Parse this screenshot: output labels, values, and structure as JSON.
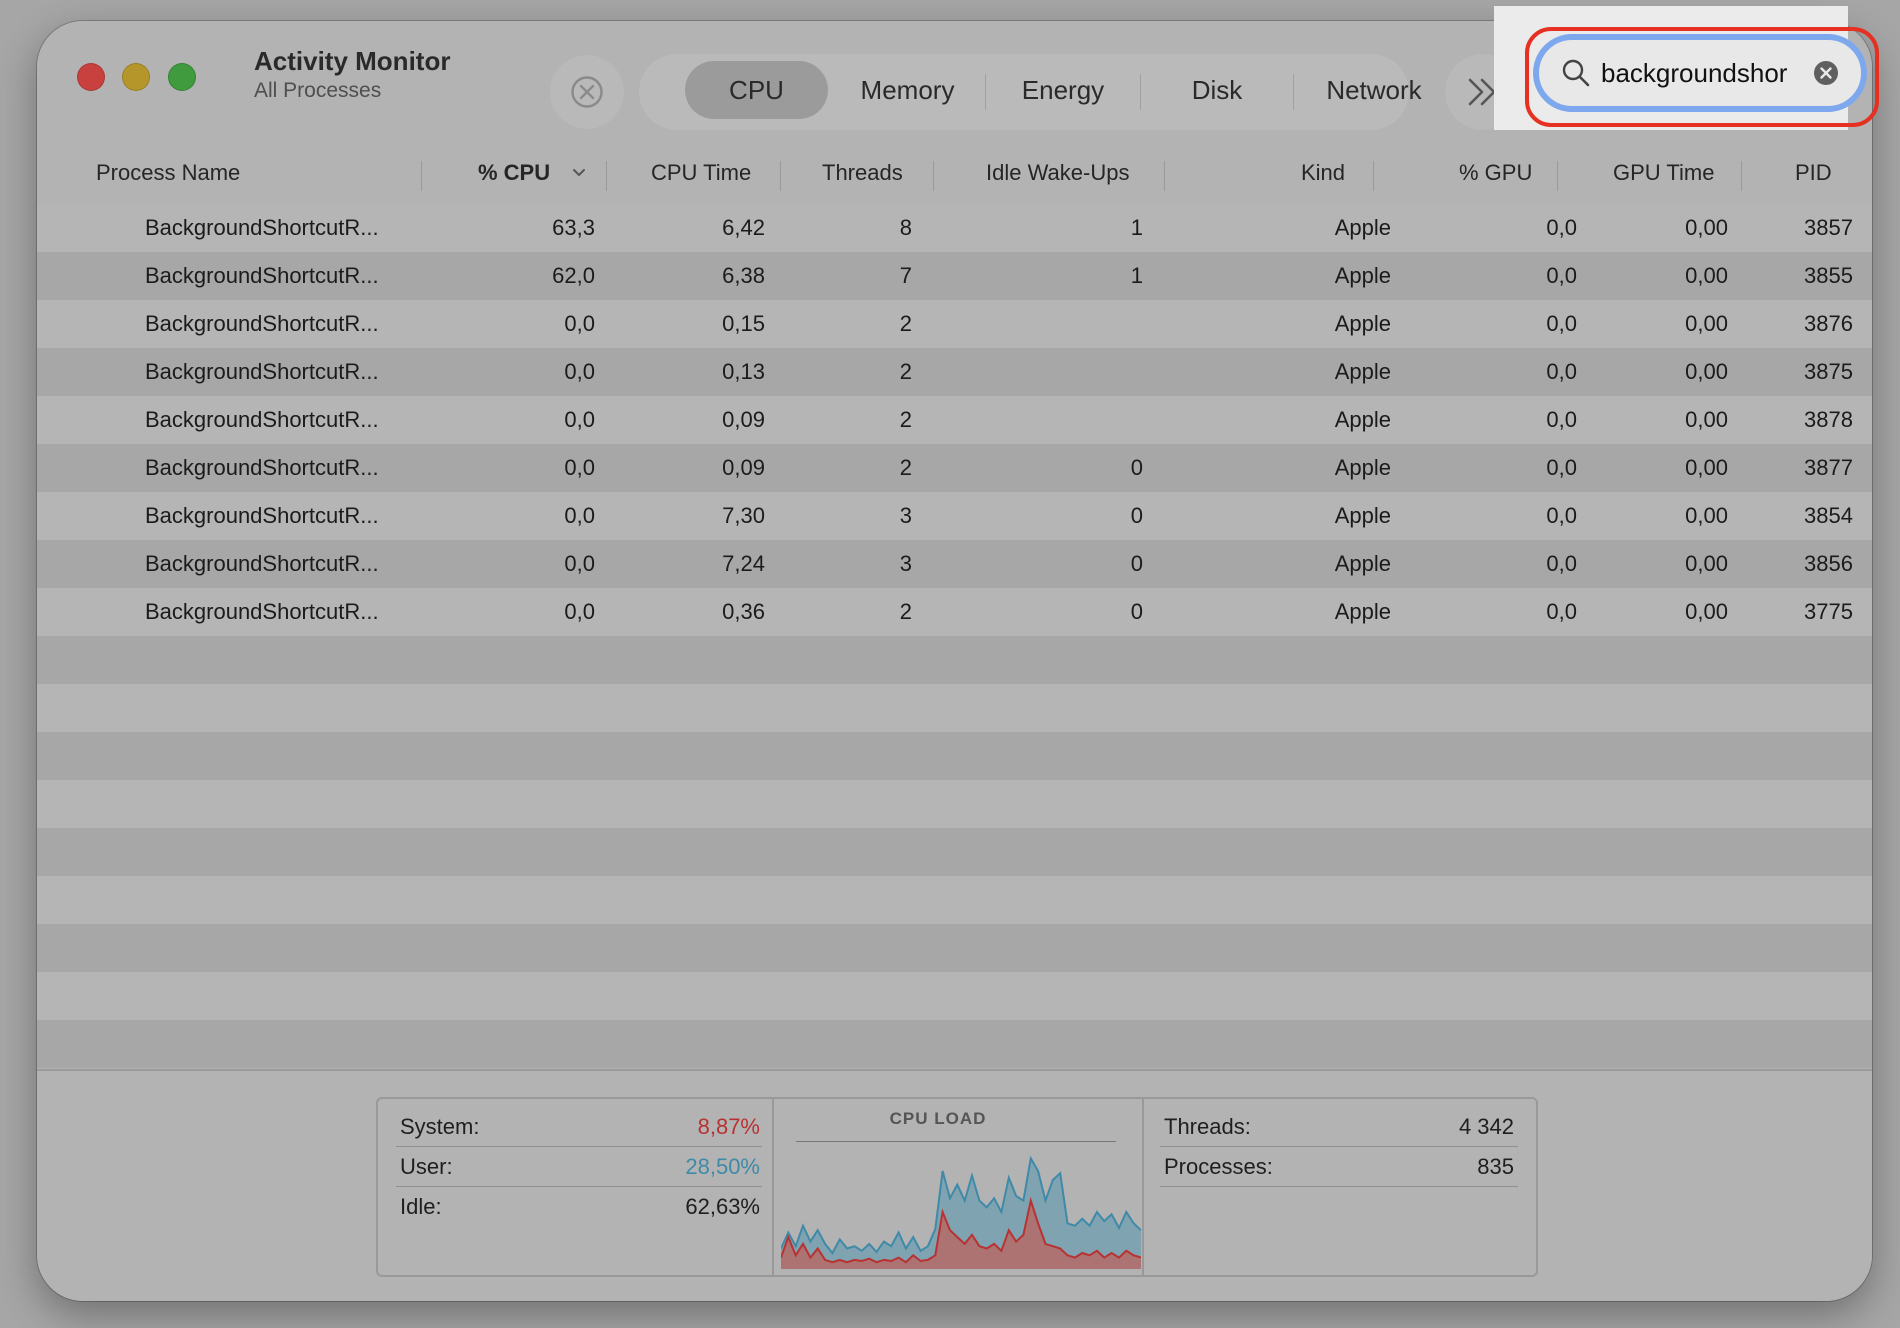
{
  "window": {
    "title": "Activity Monitor",
    "subtitle": "All Processes"
  },
  "tabs": [
    {
      "label": "CPU",
      "selected": true
    },
    {
      "label": "Memory",
      "selected": false
    },
    {
      "label": "Energy",
      "selected": false
    },
    {
      "label": "Disk",
      "selected": false
    },
    {
      "label": "Network",
      "selected": false
    }
  ],
  "search": {
    "value": "backgroundshor"
  },
  "columns": [
    "Process Name",
    "% CPU",
    "CPU Time",
    "Threads",
    "Idle Wake-Ups",
    "Kind",
    "% GPU",
    "GPU Time",
    "PID"
  ],
  "rows": [
    [
      "BackgroundShortcutR...",
      "63,3",
      "6,42",
      "8",
      "1",
      "Apple",
      "0,0",
      "0,00",
      "3857"
    ],
    [
      "BackgroundShortcutR...",
      "62,0",
      "6,38",
      "7",
      "1",
      "Apple",
      "0,0",
      "0,00",
      "3855"
    ],
    [
      "BackgroundShortcutR...",
      "0,0",
      "0,15",
      "2",
      "",
      "Apple",
      "0,0",
      "0,00",
      "3876"
    ],
    [
      "BackgroundShortcutR...",
      "0,0",
      "0,13",
      "2",
      "",
      "Apple",
      "0,0",
      "0,00",
      "3875"
    ],
    [
      "BackgroundShortcutR...",
      "0,0",
      "0,09",
      "2",
      "",
      "Apple",
      "0,0",
      "0,00",
      "3878"
    ],
    [
      "BackgroundShortcutR...",
      "0,0",
      "0,09",
      "2",
      "0",
      "Apple",
      "0,0",
      "0,00",
      "3877"
    ],
    [
      "BackgroundShortcutR...",
      "0,0",
      "7,30",
      "3",
      "0",
      "Apple",
      "0,0",
      "0,00",
      "3854"
    ],
    [
      "BackgroundShortcutR...",
      "0,0",
      "7,24",
      "3",
      "0",
      "Apple",
      "0,0",
      "0,00",
      "3856"
    ],
    [
      "BackgroundShortcutR...",
      "0,0",
      "0,36",
      "2",
      "0",
      "Apple",
      "0,0",
      "0,00",
      "3775"
    ]
  ],
  "stats": {
    "system_label": "System:",
    "system_value": "8,87%",
    "user_label": "User:",
    "user_value": "28,50%",
    "idle_label": "Idle:",
    "idle_value": "62,63%",
    "cpu_load_title": "CPU LOAD",
    "threads_label": "Threads:",
    "threads_value": "4 342",
    "processes_label": "Processes:",
    "processes_value": "835"
  },
  "colors": {
    "system": "#b83232",
    "user": "#3f8aa8",
    "search_highlight": "#e63022",
    "focus_ring": "#7ea8ee"
  },
  "cpu_load": {
    "user": [
      0.18,
      0.32,
      0.2,
      0.38,
      0.24,
      0.34,
      0.22,
      0.14,
      0.26,
      0.18,
      0.2,
      0.16,
      0.22,
      0.15,
      0.24,
      0.2,
      0.32,
      0.18,
      0.28,
      0.16,
      0.2,
      0.35,
      0.86,
      0.62,
      0.74,
      0.6,
      0.82,
      0.6,
      0.54,
      0.62,
      0.5,
      0.8,
      0.64,
      0.6,
      0.97,
      0.86,
      0.6,
      0.78,
      0.84,
      0.4,
      0.38,
      0.44,
      0.38,
      0.5,
      0.42,
      0.48,
      0.36,
      0.5,
      0.4,
      0.34
    ],
    "system": [
      0.1,
      0.28,
      0.12,
      0.22,
      0.1,
      0.18,
      0.08,
      0.06,
      0.08,
      0.06,
      0.08,
      0.07,
      0.09,
      0.06,
      0.08,
      0.07,
      0.1,
      0.06,
      0.12,
      0.07,
      0.08,
      0.12,
      0.5,
      0.34,
      0.28,
      0.22,
      0.3,
      0.2,
      0.18,
      0.22,
      0.16,
      0.34,
      0.24,
      0.3,
      0.6,
      0.4,
      0.22,
      0.2,
      0.18,
      0.12,
      0.1,
      0.14,
      0.12,
      0.16,
      0.1,
      0.14,
      0.1,
      0.16,
      0.12,
      0.1
    ]
  }
}
